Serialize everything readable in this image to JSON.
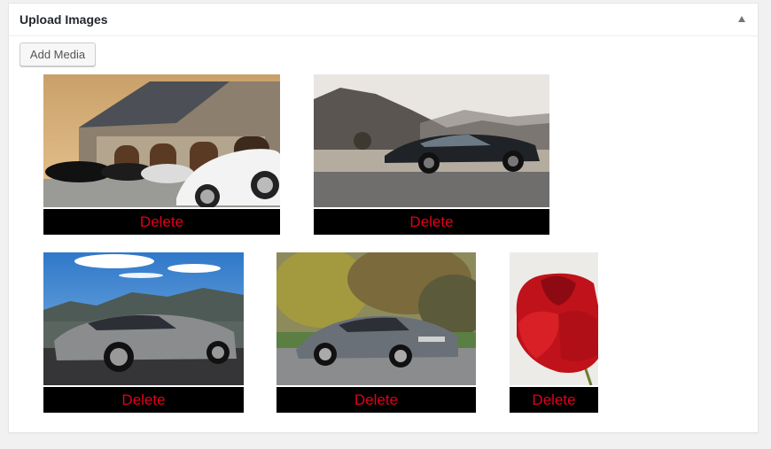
{
  "panel": {
    "title": "Upload Images",
    "add_media_label": "Add Media"
  },
  "images": [
    {
      "alt": "mansion-cars",
      "delete_label": "Delete"
    },
    {
      "alt": "desert-sedan",
      "delete_label": "Delete"
    },
    {
      "alt": "mountain-coupe",
      "delete_label": "Delete"
    },
    {
      "alt": "grey-coupe-road",
      "delete_label": "Delete"
    },
    {
      "alt": "red-rose",
      "delete_label": "Delete"
    }
  ],
  "colors": {
    "delete_text": "#e2001a",
    "delete_bg": "#000000"
  }
}
